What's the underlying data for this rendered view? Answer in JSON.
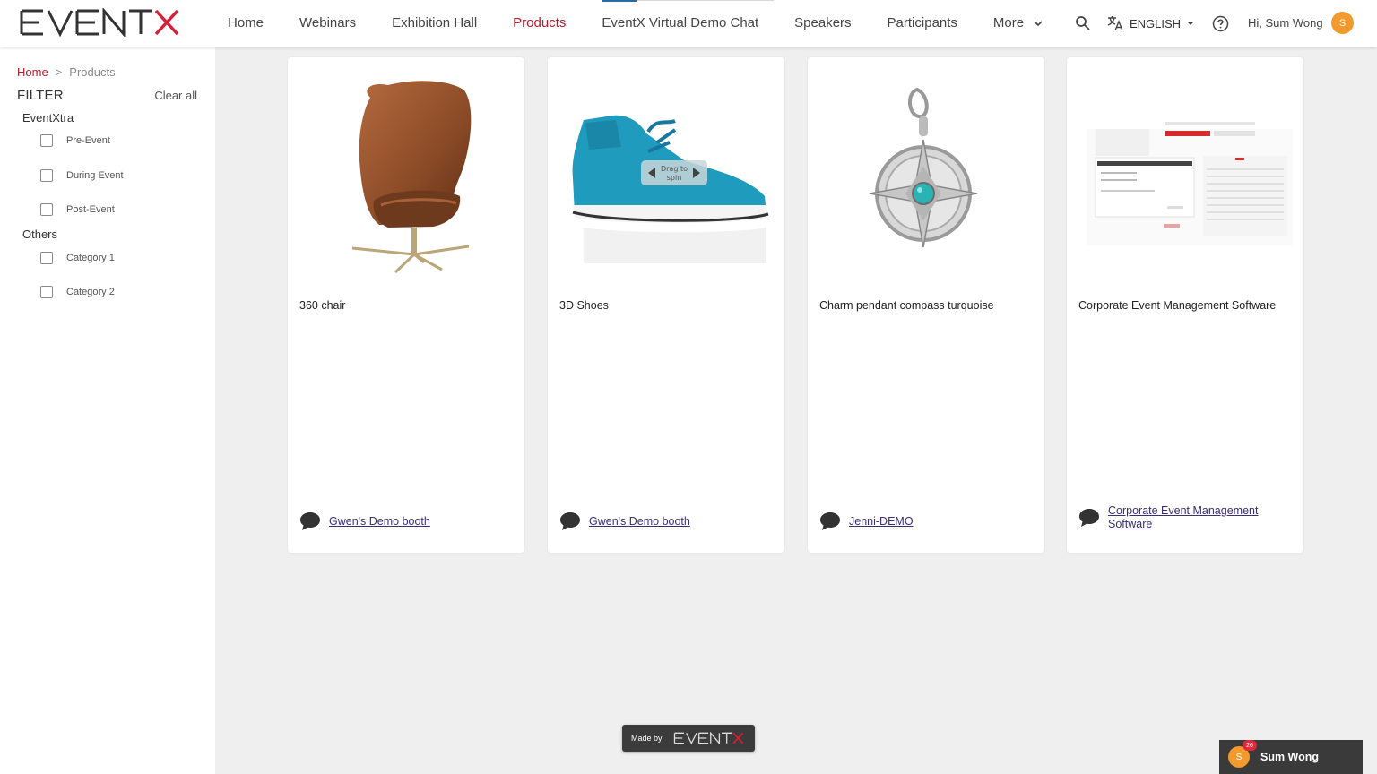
{
  "brand": {
    "logo_text": "EVENTX",
    "accent": "#b61b2e"
  },
  "nav": {
    "items": [
      {
        "label": "Home"
      },
      {
        "label": "Webinars"
      },
      {
        "label": "Exhibition Hall"
      },
      {
        "label": "Products",
        "active": true
      },
      {
        "label": "EventX Virtual Demo Chat"
      },
      {
        "label": "Speakers"
      },
      {
        "label": "Participants"
      }
    ],
    "more_label": "More"
  },
  "header": {
    "language": "ENGLISH",
    "greeting": "Hi, Sum Wong",
    "avatar_initial": "S",
    "icons": [
      "search-icon",
      "translate-icon",
      "help-icon",
      "chevron-down-icon"
    ]
  },
  "sidebar": {
    "breadcrumb": {
      "home": "Home",
      "separator": ">",
      "current": "Products"
    },
    "filter_title": "FILTER",
    "clear_all": "Clear all",
    "groups": [
      {
        "label": "EventXtra",
        "options": [
          "Pre-Event",
          "During Event",
          "Post-Event"
        ]
      },
      {
        "label": "Others",
        "options": [
          "Category 1",
          "Category 2"
        ]
      }
    ]
  },
  "products": [
    {
      "title": "360 chair",
      "booth": "Gwen's Demo booth",
      "image": "chair"
    },
    {
      "title": "3D Shoes",
      "booth": "Gwen's Demo booth",
      "image": "shoe",
      "overlay_line1": "Drag to",
      "overlay_line2": "spin"
    },
    {
      "title": "Charm pendant compass turquoise",
      "booth": "Jenni-DEMO",
      "image": "pendant"
    },
    {
      "title": "Corporate Event Management Software",
      "booth": "Corporate Event Management Software",
      "image": "software-screenshot"
    }
  ],
  "footer": {
    "made_by": "Made by",
    "made_by_logo": "EVENTX"
  },
  "chat": {
    "name": "Sum Wong",
    "avatar_initial": "S",
    "badge_count": "26"
  }
}
